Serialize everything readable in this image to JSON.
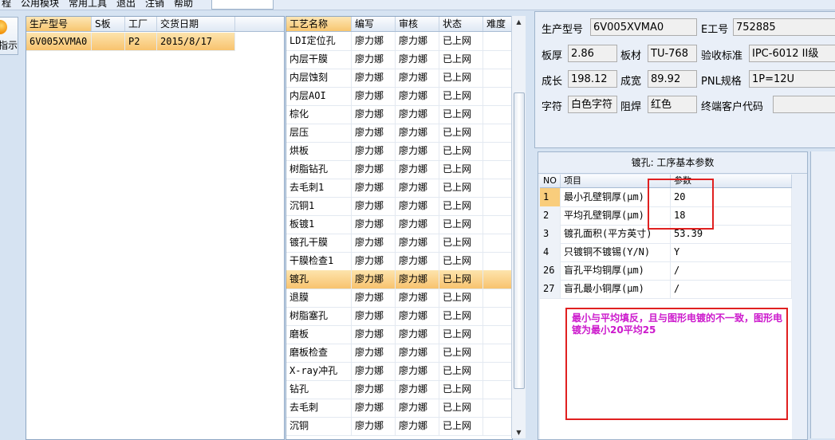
{
  "menu": {
    "items": [
      "程",
      "公用模块",
      "常用工具",
      "退出",
      "注销",
      "帮助"
    ],
    "combo_value": ""
  },
  "left_button": {
    "label": "指示",
    "icon": "warning-icon"
  },
  "orders_grid": {
    "columns": [
      "生产型号",
      "S板",
      "工厂",
      "交货日期"
    ],
    "rows": [
      {
        "model": "6V005XVMA0",
        "s_board": "",
        "factory": "P2",
        "delivery_date": "2015/8/17"
      }
    ]
  },
  "process_grid": {
    "columns": [
      "工艺名称",
      "编写",
      "审核",
      "状态",
      "难度"
    ],
    "rows": [
      {
        "name": "LDI定位孔",
        "writer": "廖力娜",
        "reviewer": "廖力娜",
        "status": "已上网",
        "difficulty": ""
      },
      {
        "name": "内层干膜",
        "writer": "廖力娜",
        "reviewer": "廖力娜",
        "status": "已上网",
        "difficulty": ""
      },
      {
        "name": "内层蚀刻",
        "writer": "廖力娜",
        "reviewer": "廖力娜",
        "status": "已上网",
        "difficulty": ""
      },
      {
        "name": "内层AOI",
        "writer": "廖力娜",
        "reviewer": "廖力娜",
        "status": "已上网",
        "difficulty": ""
      },
      {
        "name": "棕化",
        "writer": "廖力娜",
        "reviewer": "廖力娜",
        "status": "已上网",
        "difficulty": ""
      },
      {
        "name": "层压",
        "writer": "廖力娜",
        "reviewer": "廖力娜",
        "status": "已上网",
        "difficulty": ""
      },
      {
        "name": "烘板",
        "writer": "廖力娜",
        "reviewer": "廖力娜",
        "status": "已上网",
        "difficulty": ""
      },
      {
        "name": "树脂钻孔",
        "writer": "廖力娜",
        "reviewer": "廖力娜",
        "status": "已上网",
        "difficulty": ""
      },
      {
        "name": "去毛刺1",
        "writer": "廖力娜",
        "reviewer": "廖力娜",
        "status": "已上网",
        "difficulty": ""
      },
      {
        "name": "沉铜1",
        "writer": "廖力娜",
        "reviewer": "廖力娜",
        "status": "已上网",
        "difficulty": ""
      },
      {
        "name": "板镀1",
        "writer": "廖力娜",
        "reviewer": "廖力娜",
        "status": "已上网",
        "difficulty": ""
      },
      {
        "name": "镀孔干膜",
        "writer": "廖力娜",
        "reviewer": "廖力娜",
        "status": "已上网",
        "difficulty": ""
      },
      {
        "name": "干膜检查1",
        "writer": "廖力娜",
        "reviewer": "廖力娜",
        "status": "已上网",
        "difficulty": ""
      },
      {
        "name": "镀孔",
        "writer": "廖力娜",
        "reviewer": "廖力娜",
        "status": "已上网",
        "difficulty": "",
        "selected": true
      },
      {
        "name": "退膜",
        "writer": "廖力娜",
        "reviewer": "廖力娜",
        "status": "已上网",
        "difficulty": ""
      },
      {
        "name": "树脂塞孔",
        "writer": "廖力娜",
        "reviewer": "廖力娜",
        "status": "已上网",
        "difficulty": ""
      },
      {
        "name": "磨板",
        "writer": "廖力娜",
        "reviewer": "廖力娜",
        "status": "已上网",
        "difficulty": ""
      },
      {
        "name": "磨板检查",
        "writer": "廖力娜",
        "reviewer": "廖力娜",
        "status": "已上网",
        "difficulty": ""
      },
      {
        "name": "X-ray冲孔",
        "writer": "廖力娜",
        "reviewer": "廖力娜",
        "status": "已上网",
        "difficulty": ""
      },
      {
        "name": "钻孔",
        "writer": "廖力娜",
        "reviewer": "廖力娜",
        "status": "已上网",
        "difficulty": ""
      },
      {
        "name": "去毛刺",
        "writer": "廖力娜",
        "reviewer": "廖力娜",
        "status": "已上网",
        "difficulty": ""
      },
      {
        "name": "沉铜",
        "writer": "廖力娜",
        "reviewer": "廖力娜",
        "status": "已上网",
        "difficulty": ""
      }
    ]
  },
  "info": {
    "model_label": "生产型号",
    "model_value": "6V005XVMA0",
    "eno_label": "E工号",
    "eno_value": "752885",
    "thickness_label": "板厚",
    "thickness_value": "2.86",
    "material_label": "板材",
    "material_value": "TU-768",
    "standard_label": "验收标准",
    "standard_value": "IPC-6012 II级",
    "length_label": "成长",
    "length_value": "198.12",
    "width_label": "成宽",
    "width_value": "89.92",
    "pnl_label": "PNL规格",
    "pnl_value": "1P=12U",
    "char_label": "字符",
    "char_value": "白色字符",
    "mask_label": "阻焊",
    "mask_value": "红色",
    "customer_label": "终端客户代码",
    "customer_value": ""
  },
  "plating": {
    "title": "镀孔: 工序基本参数",
    "columns": [
      "NO",
      "项目",
      "参数"
    ],
    "rows": [
      {
        "no": "1",
        "item": "最小孔壁铜厚(μm)",
        "param": "20",
        "selected": true
      },
      {
        "no": "2",
        "item": "平均孔壁铜厚(μm)",
        "param": "18"
      },
      {
        "no": "3",
        "item": "镀孔面积(平方英寸)",
        "param": "53.39"
      },
      {
        "no": "4",
        "item": "只镀铜不镀锡(Y/N)",
        "param": "Y"
      },
      {
        "no": "26",
        "item": "盲孔平均铜厚(μm)",
        "param": "/"
      },
      {
        "no": "27",
        "item": "盲孔最小铜厚(μm)",
        "param": "/"
      }
    ]
  },
  "annotation": {
    "note": "最小与平均填反，且与图形电镀的不一致，图形电镀为最小20平均25",
    "box_color": "#e02020",
    "text_color": "#cc19cc"
  }
}
